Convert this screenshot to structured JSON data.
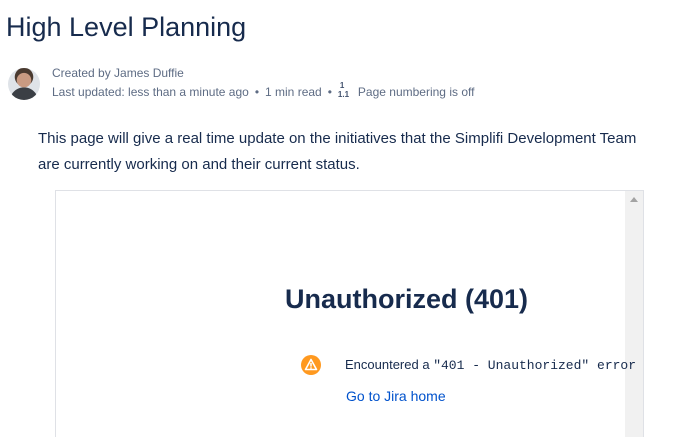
{
  "page": {
    "title": "High Level Planning"
  },
  "byline": {
    "created_by": "Created by James Duffie",
    "last_updated": "Last updated: less than a minute ago",
    "separator": "•",
    "read_time": "1 min read",
    "numbering_icon_top": "1",
    "numbering_icon_bottom": "1.1",
    "page_numbering": "Page numbering is off"
  },
  "content": {
    "intro": "This page will give a real time update on the initiatives that the Simplifi Development Team are currently working on and their current status."
  },
  "embedded_macro": {
    "error_title": "Unauthorized (401)",
    "error_message_prefix": "Encountered a ",
    "error_message_code": "\"401 - Unauthorized\" error",
    "link_label": "Go to Jira home"
  },
  "colors": {
    "text_primary": "#172b4d",
    "text_secondary": "#5e6c84",
    "link": "#0052cc",
    "warning": "#ff991f"
  },
  "icons": {
    "avatar": "user-avatar",
    "numbering": "page-numbering-icon",
    "warning": "warning-icon",
    "scroll_up": "scroll-up-arrow-icon"
  }
}
